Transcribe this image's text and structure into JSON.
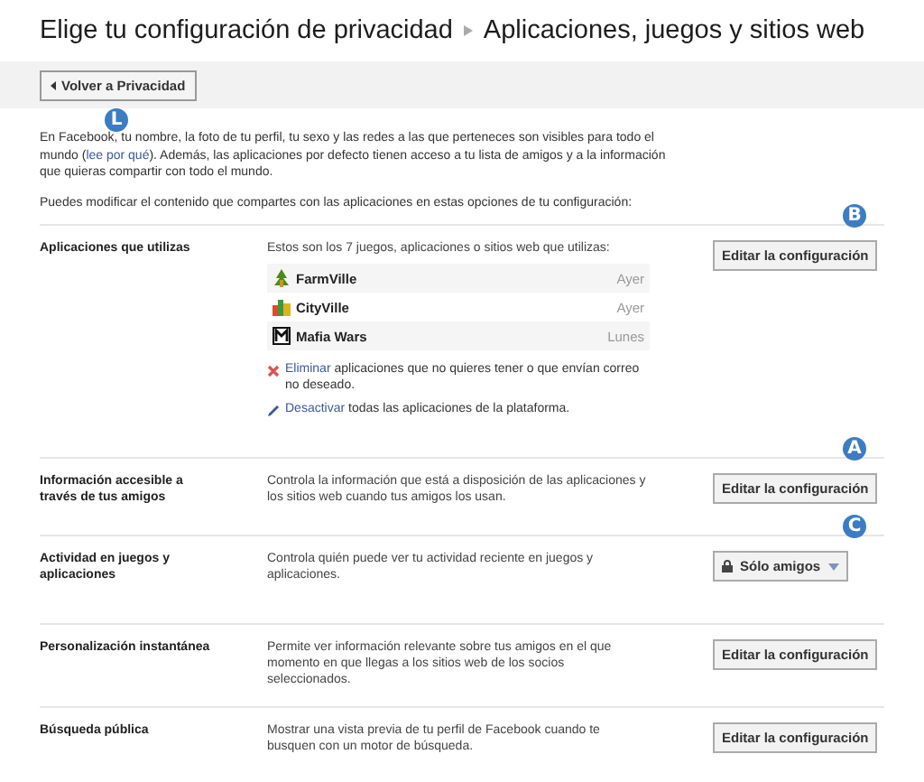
{
  "header": {
    "title": "Elige tu configuración de privacidad",
    "subtitle": "Aplicaciones, juegos y sitios web"
  },
  "back_button": {
    "label": "Volver a Privacidad",
    "marker": "L"
  },
  "intro": [
    {
      "before": "En Facebook, tu nombre, la foto de tu perfil, tu sexo y las redes a las que perteneces son visibles para todo el mundo (",
      "link": "lee por qué",
      "after": "). Además, las aplicaciones por defecto tienen acceso a tu lista de amigos y a la información que quieras compartir con todo el mundo."
    },
    {
      "before": "Puedes modificar el contenido que compartes con las aplicaciones en estas opciones de tu configuración:"
    }
  ],
  "settings": [
    {
      "label": "Aplicaciones que utilizas",
      "kind": "apps",
      "marker": "B",
      "description": "Estos son los 7 juegos, aplicaciones o sitios web que utilizas:",
      "apps": [
        {
          "name": "FarmVille",
          "when": "Ayer",
          "kind": "plant"
        },
        {
          "name": "CityVille",
          "when": "Ayer",
          "kind": "city"
        },
        {
          "name": "Mafia Wars",
          "when": "Lunes",
          "kind": "frame"
        }
      ],
      "actions": [
        {
          "kind": "remove",
          "link": "Eliminar",
          "text": "aplicaciones que no quieres tener o que envían correo no deseado."
        },
        {
          "kind": "disable",
          "link": "Desactivar",
          "text": "todas las aplicaciones de la plataforma."
        }
      ],
      "control": {
        "kind": "button",
        "label": "Editar la configuración"
      }
    },
    {
      "label": "Información accesible a través de tus amigos",
      "kind": "text",
      "marker": "A",
      "description": "Controla la información que está a disposición de las aplicaciones y los sitios web cuando tus amigos los usan.",
      "control": {
        "kind": "button",
        "label": "Editar la configuración"
      }
    },
    {
      "label": "Actividad en juegos y aplicaciones",
      "kind": "text",
      "marker": "C",
      "description": "Controla quién puede ver tu actividad reciente en juegos y aplicaciones.",
      "control": {
        "kind": "dropdown",
        "label": "Sólo amigos"
      }
    },
    {
      "label": "Personalización instantánea",
      "kind": "text",
      "description": "Permite ver información relevante sobre tus amigos en el que momento en que llegas a los sitios web de los socios seleccionados.",
      "control": {
        "kind": "button",
        "label": "Editar la configuración"
      }
    },
    {
      "label": "Búsqueda pública",
      "kind": "text",
      "description": "Mostrar una vista previa de tu perfil de Facebook cuando te busquen con un motor de búsqueda.",
      "control": {
        "kind": "button",
        "label": "Editar la configuración"
      }
    }
  ]
}
